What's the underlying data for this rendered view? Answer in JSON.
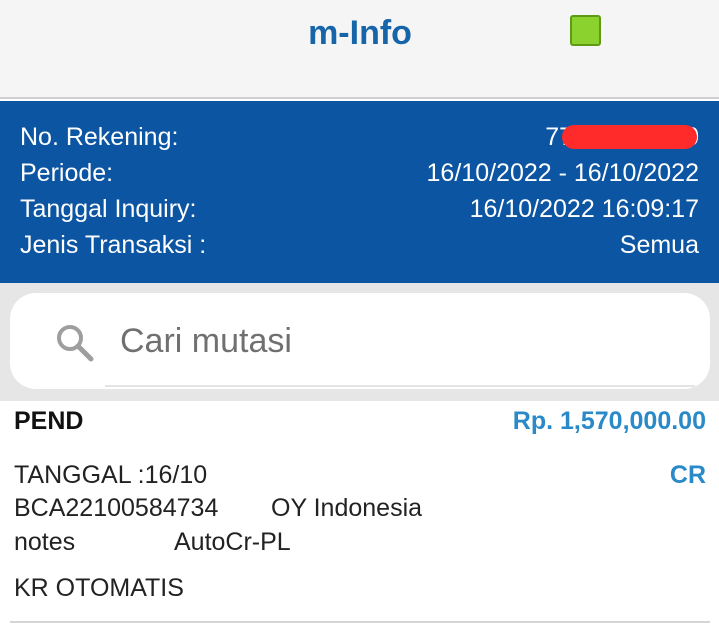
{
  "header": {
    "title": "m-Info",
    "status_color": "#8bd22f"
  },
  "account_info": {
    "rekening_label": "No. Rekening:",
    "rekening_value_visible_start": "77",
    "rekening_value_visible_end": "0",
    "periode_label": "Periode:",
    "periode_value": "16/10/2022 - 16/10/2022",
    "tanggal_label": "Tanggal Inquiry:",
    "tanggal_value": "16/10/2022 16:09:17",
    "jenis_label": "Jenis Transaksi :",
    "jenis_value": "Semua"
  },
  "search": {
    "placeholder": "Cari mutasi",
    "icon": "search-icon"
  },
  "transaction": {
    "status": "PEND",
    "amount": "Rp. 1,570,000.00",
    "type": "CR",
    "date_line": "TANGGAL :16/10",
    "ref": "BCA22100584734",
    "counterparty": "OY Indonesia",
    "notes_label": "notes",
    "notes_value": "AutoCr-PL",
    "description": "KR OTOMATIS"
  },
  "colors": {
    "panel_blue": "#0b55a2",
    "title_blue": "#1565a8",
    "accent_blue": "#2a8ac8"
  }
}
